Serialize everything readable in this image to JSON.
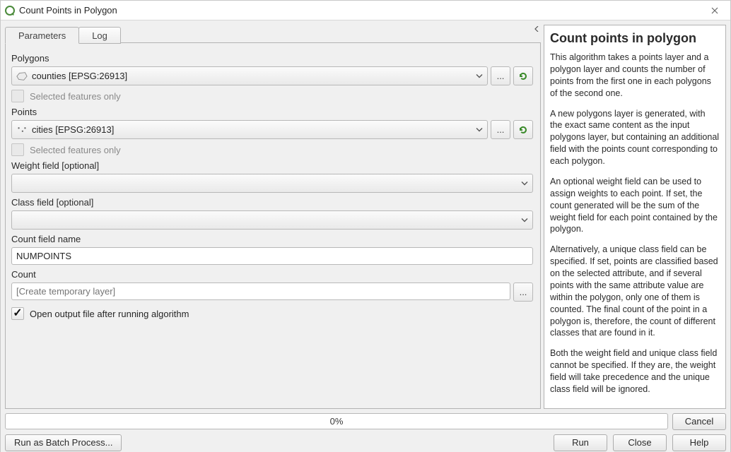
{
  "window": {
    "title": "Count Points in Polygon",
    "close_label": "×"
  },
  "tabs": {
    "parameters": "Parameters",
    "log": "Log"
  },
  "params": {
    "polygons_label": "Polygons",
    "polygons_value": "counties [EPSG:26913]",
    "selected_only": "Selected features only",
    "points_label": "Points",
    "points_value": "cities [EPSG:26913]",
    "weight_label": "Weight field [optional]",
    "weight_value": "",
    "class_label": "Class field [optional]",
    "class_value": "",
    "count_field_label": "Count field name",
    "count_field_value": "NUMPOINTS",
    "count_label": "Count",
    "count_placeholder": "[Create temporary layer]",
    "open_output_label": "Open output file after running algorithm"
  },
  "help": {
    "title": "Count points in polygon",
    "p1": "This algorithm takes a points layer and a polygon layer and counts the number of points from the first one in each polygons of the second one.",
    "p2": "A new polygons layer is generated, with the exact same content as the input polygons layer, but containing an additional field with the points count corresponding to each polygon.",
    "p3": "An optional weight field can be used to assign weights to each point. If set, the count generated will be the sum of the weight field for each point contained by the polygon.",
    "p4": "Alternatively, a unique class field can be specified. If set, points are classified based on the selected attribute, and if several points with the same attribute value are within the polygon, only one of them is counted. The final count of the point in a polygon is, therefore, the count of different classes that are found in it.",
    "p5": "Both the weight field and unique class field cannot be specified. If they are, the weight field will take precedence and the unique class field will be ignored."
  },
  "footer": {
    "progress": "0%",
    "cancel": "Cancel",
    "batch": "Run as Batch Process...",
    "run": "Run",
    "close": "Close",
    "help": "Help"
  }
}
